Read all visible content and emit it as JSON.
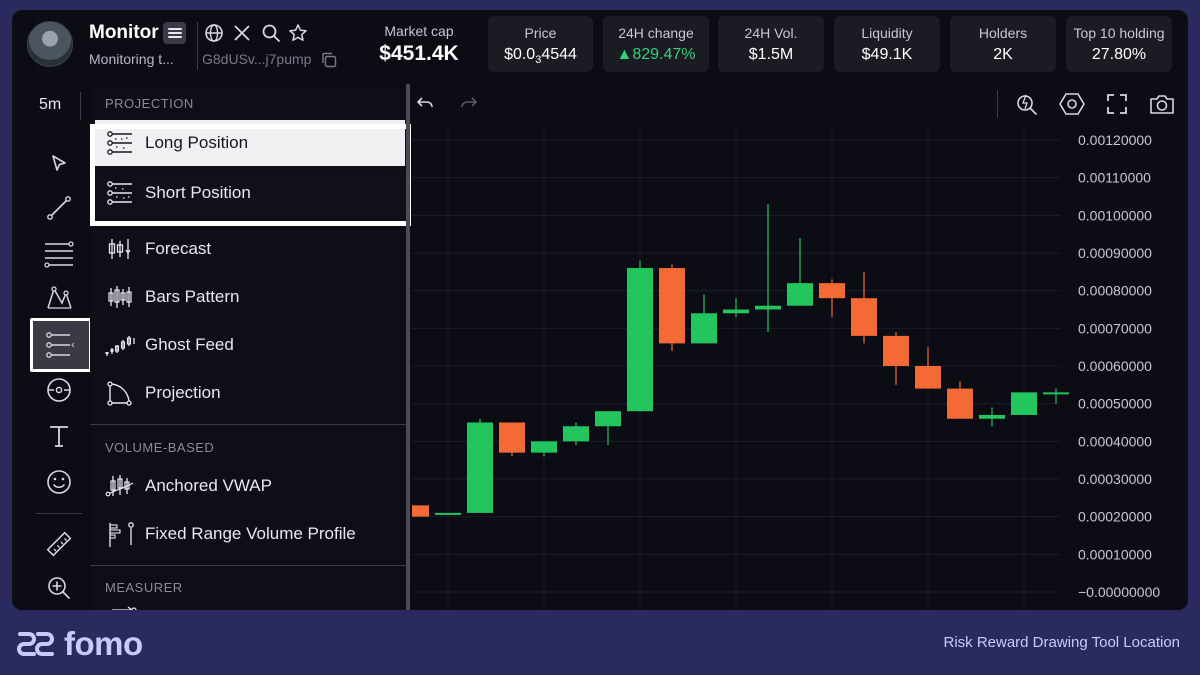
{
  "token": {
    "name": "Monitor",
    "subtitle": "Monitoring t...",
    "address": "G8dUSv...j7pump"
  },
  "stats": {
    "market_cap": {
      "label": "Market cap",
      "value": "$451.4K"
    },
    "price": {
      "label": "Price",
      "value_prefix": "$0.0",
      "value_sub": "3",
      "value_suffix": "4544"
    },
    "change_24h": {
      "label": "24H change",
      "value": "▲829.47%",
      "color": "#33d17a"
    },
    "vol_24h": {
      "label": "24H Vol.",
      "value": "$1.5M"
    },
    "liquidity": {
      "label": "Liquidity",
      "value": "$49.1K"
    },
    "holders": {
      "label": "Holders",
      "value": "2K"
    },
    "top10": {
      "label": "Top 10 holding",
      "value": "27.80%"
    }
  },
  "toolbar": {
    "timeframe": "5m",
    "icons": [
      "cursor-icon",
      "trendline-icon",
      "fib-lines-icon",
      "pattern-icon",
      "position-icon",
      "circle-target-icon",
      "text-icon",
      "emoji-icon",
      "ruler-icon",
      "zoom-in-icon"
    ]
  },
  "menu": {
    "sections": [
      {
        "title": "PROJECTION",
        "items": [
          "Long Position",
          "Short Position",
          "Forecast",
          "Bars Pattern",
          "Ghost Feed",
          "Projection"
        ]
      },
      {
        "title": "VOLUME-BASED",
        "items": [
          "Anchored VWAP",
          "Fixed Range Volume Profile"
        ]
      },
      {
        "title": "MEASURER",
        "items": []
      }
    ]
  },
  "colors": {
    "up": "#22c55e",
    "down": "#f46a37",
    "accent": "#c9c9ff",
    "background": "#0c0c14"
  },
  "chart_data": {
    "type": "candlestick",
    "y_ticks": [
      "0.00120000",
      "0.00110000",
      "0.00100000",
      "0.00090000",
      "0.00080000",
      "0.00070000",
      "0.00060000",
      "0.00050000",
      "0.00040000",
      "0.00030000",
      "0.00020000",
      "0.00010000",
      "−0.00000000"
    ],
    "ylim": [
      0.0,
      0.0012
    ],
    "grid": true,
    "candles": [
      {
        "o": 0.00023,
        "h": 0.00023,
        "l": 0.0002,
        "c": 0.0002
      },
      {
        "o": 0.00021,
        "h": 0.00021,
        "l": 0.00021,
        "c": 0.00021
      },
      {
        "o": 0.00021,
        "h": 0.00046,
        "l": 0.00021,
        "c": 0.00045
      },
      {
        "o": 0.00045,
        "h": 0.00045,
        "l": 0.00036,
        "c": 0.00037
      },
      {
        "o": 0.00037,
        "h": 0.0004,
        "l": 0.00036,
        "c": 0.0004
      },
      {
        "o": 0.0004,
        "h": 0.00045,
        "l": 0.00039,
        "c": 0.00044
      },
      {
        "o": 0.00044,
        "h": 0.00048,
        "l": 0.00039,
        "c": 0.00048
      },
      {
        "o": 0.00048,
        "h": 0.00088,
        "l": 0.00048,
        "c": 0.00086
      },
      {
        "o": 0.00086,
        "h": 0.00087,
        "l": 0.00064,
        "c": 0.00066
      },
      {
        "o": 0.00066,
        "h": 0.00079,
        "l": 0.00066,
        "c": 0.00074
      },
      {
        "o": 0.00074,
        "h": 0.00078,
        "l": 0.00073,
        "c": 0.00075
      },
      {
        "o": 0.00075,
        "h": 0.00103,
        "l": 0.00069,
        "c": 0.00076
      },
      {
        "o": 0.00076,
        "h": 0.00094,
        "l": 0.00076,
        "c": 0.00082
      },
      {
        "o": 0.00082,
        "h": 0.00083,
        "l": 0.00073,
        "c": 0.00078
      },
      {
        "o": 0.00078,
        "h": 0.00085,
        "l": 0.00066,
        "c": 0.00068
      },
      {
        "o": 0.00068,
        "h": 0.00069,
        "l": 0.00055,
        "c": 0.0006
      },
      {
        "o": 0.0006,
        "h": 0.00065,
        "l": 0.00054,
        "c": 0.00054
      },
      {
        "o": 0.00054,
        "h": 0.00056,
        "l": 0.00046,
        "c": 0.00046
      },
      {
        "o": 0.00046,
        "h": 0.00049,
        "l": 0.00044,
        "c": 0.00047
      },
      {
        "o": 0.00047,
        "h": 0.00053,
        "l": 0.00047,
        "c": 0.00053
      },
      {
        "o": 0.00053,
        "h": 0.00054,
        "l": 0.0005,
        "c": 0.00053
      }
    ]
  },
  "footer": {
    "brand": "fomo",
    "caption": "Risk Reward Drawing Tool Location"
  }
}
